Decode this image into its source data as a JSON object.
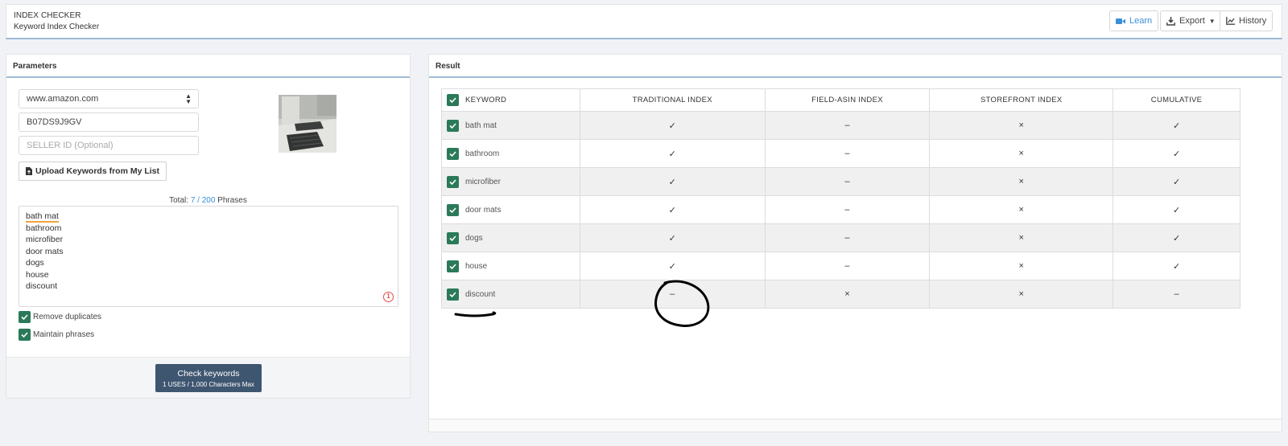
{
  "header": {
    "title": "INDEX CHECKER",
    "subtitle": "Keyword Index Checker",
    "learn_label": "Learn",
    "export_label": "Export",
    "history_label": "History"
  },
  "params": {
    "heading": "Parameters",
    "marketplace": "www.amazon.com",
    "asin": "B07DS9J9GV",
    "seller_placeholder": "SELLER ID (Optional)",
    "upload_label": "Upload Keywords from My List",
    "total_label": "Total:",
    "total_used": "7",
    "total_sep": "/",
    "total_max": "200",
    "total_unit": "Phrases",
    "keywords": [
      "bath mat",
      "bathroom",
      "microfiber",
      "door mats",
      "dogs",
      "house",
      "discount"
    ],
    "error_count": "1",
    "remove_duplicates_label": "Remove duplicates",
    "maintain_phrases_label": "Maintain phrases",
    "check_label": "Check keywords",
    "check_sub": "1 USES / 1,000 Characters Max"
  },
  "result": {
    "heading": "Result",
    "columns": [
      "KEYWORD",
      "TRADITIONAL INDEX",
      "FIELD-ASIN INDEX",
      "STOREFRONT INDEX",
      "CUMULATIVE"
    ],
    "rows": [
      {
        "keyword": "bath mat",
        "traditional": "✓",
        "field_asin": "–",
        "storefront": "×",
        "cumulative": "✓"
      },
      {
        "keyword": "bathroom",
        "traditional": "✓",
        "field_asin": "–",
        "storefront": "×",
        "cumulative": "✓"
      },
      {
        "keyword": "microfiber",
        "traditional": "✓",
        "field_asin": "–",
        "storefront": "×",
        "cumulative": "✓"
      },
      {
        "keyword": "door mats",
        "traditional": "✓",
        "field_asin": "–",
        "storefront": "×",
        "cumulative": "✓"
      },
      {
        "keyword": "dogs",
        "traditional": "✓",
        "field_asin": "–",
        "storefront": "×",
        "cumulative": "✓"
      },
      {
        "keyword": "house",
        "traditional": "✓",
        "field_asin": "–",
        "storefront": "×",
        "cumulative": "✓"
      },
      {
        "keyword": "discount",
        "traditional": "–",
        "field_asin": "×",
        "storefront": "×",
        "cumulative": "–"
      }
    ]
  },
  "colors": {
    "accent_blue": "#3b8fd9",
    "checkbox_green": "#2a7a5a",
    "button_dark": "#3f5670",
    "error_red": "#e04a4a"
  }
}
